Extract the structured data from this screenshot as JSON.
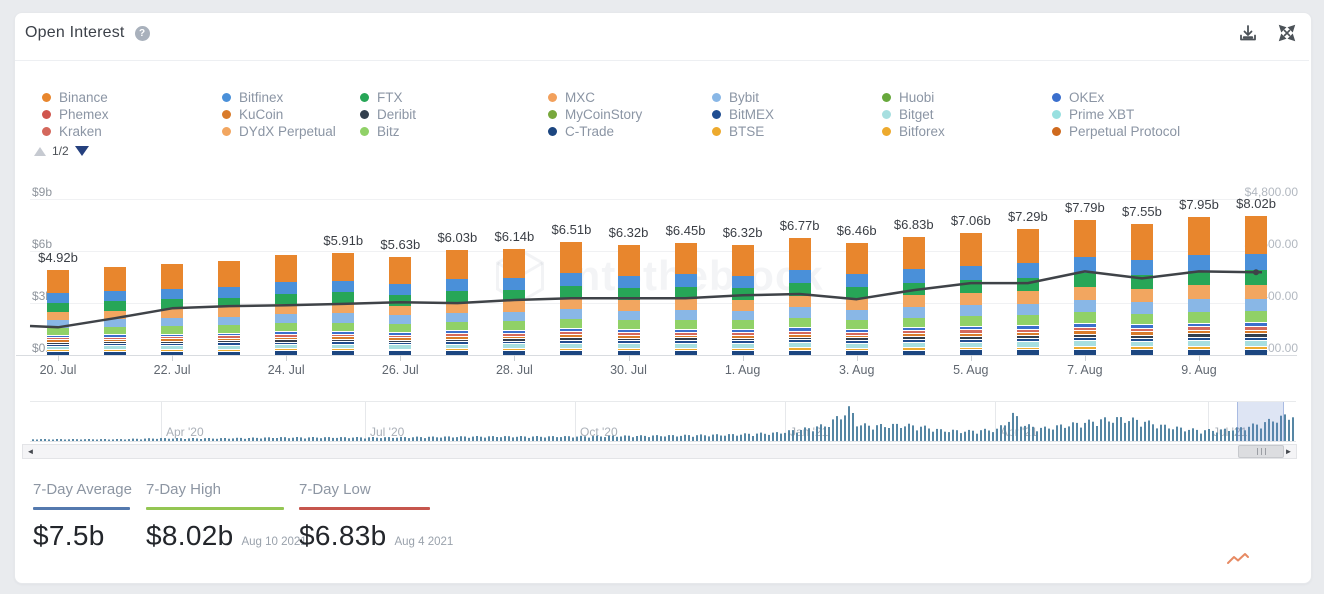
{
  "header": {
    "title": "Open Interest",
    "help_icon": "question-mark-icon",
    "download_icon": "download-icon",
    "expand_icon": "expand-icon"
  },
  "legend": {
    "pagination": {
      "label": "1/2",
      "up_icon": "triangle-up-icon",
      "down_icon": "triangle-down-icon"
    },
    "columns": [
      [
        {
          "name": "Binance",
          "color": "#e8862d"
        },
        {
          "name": "Phemex",
          "color": "#d0564e"
        },
        {
          "name": "Kraken",
          "color": "#d4685c"
        }
      ],
      [
        {
          "name": "Bitfinex",
          "color": "#4a90d9"
        },
        {
          "name": "KuCoin",
          "color": "#d97b2a"
        },
        {
          "name": "DYdX Perpetual",
          "color": "#f2a660"
        }
      ],
      [
        {
          "name": "FTX",
          "color": "#27a657"
        },
        {
          "name": "Deribit",
          "color": "#333f4d"
        },
        {
          "name": "Bitz",
          "color": "#90d167"
        }
      ],
      [
        {
          "name": "MXC",
          "color": "#f2a05c"
        },
        {
          "name": "MyCoinStory",
          "color": "#78a83c"
        },
        {
          "name": "C-Trade",
          "color": "#1c4680"
        }
      ],
      [
        {
          "name": "Bybit",
          "color": "#89b7e6"
        },
        {
          "name": "BitMEX",
          "color": "#1f4d91"
        },
        {
          "name": "BTSE",
          "color": "#edaa2e"
        }
      ],
      [
        {
          "name": "Huobi",
          "color": "#67a83c"
        },
        {
          "name": "Bitget",
          "color": "#a7dfe0"
        },
        {
          "name": "Bitforex",
          "color": "#edaa2e"
        }
      ],
      [
        {
          "name": "OKEx",
          "color": "#3b6fcd"
        },
        {
          "name": "Prime XBT",
          "color": "#98e0e0"
        },
        {
          "name": "Perpetual Protocol",
          "color": "#cf6a1e"
        }
      ]
    ]
  },
  "watermark": "intotheblock",
  "chart_data": {
    "type": "bar",
    "stacked": true,
    "title": "Open Interest",
    "x": [
      "Jul 20",
      "Jul 21",
      "Jul 22",
      "Jul 23",
      "Jul 24",
      "Jul 25",
      "Jul 26",
      "Jul 27",
      "Jul 28",
      "Jul 29",
      "Jul 30",
      "Jul 31",
      "Aug 1",
      "Aug 2",
      "Aug 3",
      "Aug 4",
      "Aug 5",
      "Aug 6",
      "Aug 7",
      "Aug 8",
      "Aug 9",
      "Aug 10"
    ],
    "values": [
      4.92,
      5.08,
      5.26,
      5.43,
      5.78,
      5.91,
      5.63,
      6.03,
      6.14,
      6.51,
      6.32,
      6.45,
      6.32,
      6.77,
      6.46,
      6.83,
      7.06,
      7.29,
      7.79,
      7.55,
      7.95,
      8.02
    ],
    "bar_labels": [
      "$4.92b",
      null,
      null,
      null,
      null,
      "$5.91b",
      "$5.63b",
      "$6.03b",
      "$6.14b",
      "$6.51b",
      "$6.32b",
      "$6.45b",
      "$6.32b",
      "$6.77b",
      "$6.46b",
      "$6.83b",
      "$7.06b",
      "$7.29b",
      "$7.79b",
      "$7.55b",
      "$7.95b",
      "$8.02b"
    ],
    "x_tick_labels": [
      "20. Jul",
      "22. Jul",
      "24. Jul",
      "26. Jul",
      "28. Jul",
      "30. Jul",
      "1. Aug",
      "3. Aug",
      "5. Aug",
      "7. Aug",
      "9. Aug"
    ],
    "left_axis": {
      "unit": "$b",
      "range": [
        0,
        9
      ],
      "ticks": [
        {
          "v": 0,
          "label": "$0.00"
        },
        {
          "v": 3,
          "label": "$3b"
        },
        {
          "v": 6,
          "label": "$6b"
        },
        {
          "v": 9,
          "label": "$9b"
        }
      ]
    },
    "right_axis": {
      "unit": "$",
      "ticks": [
        {
          "v": 1200,
          "label": "$1,200.00"
        },
        {
          "v": 2400,
          "label": "$2,400.00"
        },
        {
          "v": 3600,
          "label": "$3,600.00"
        },
        {
          "v": 4800,
          "label": "$4,800.00"
        }
      ]
    },
    "price_line": {
      "name": "price-line",
      "color": "#3f4348",
      "values": [
        1700,
        1910,
        2140,
        2190,
        2210,
        2240,
        2280,
        2260,
        2330,
        2370,
        2370,
        2370,
        2440,
        2470,
        2350,
        2560,
        2720,
        2720,
        2990,
        2830,
        2990,
        2970
      ]
    },
    "stack_profile": [
      {
        "name": "Binance",
        "color": "#e8862d",
        "frac": 0.275,
        "stripe": false
      },
      {
        "name": "Bitfinex",
        "color": "#4a90d9",
        "frac": 0.115,
        "stripe": false
      },
      {
        "name": "FTX",
        "color": "#27a657",
        "frac": 0.105,
        "stripe": false
      },
      {
        "name": "DYdX Perpetual",
        "color": "#f2a660",
        "frac": 0.1,
        "stripe": false
      },
      {
        "name": "Bybit",
        "color": "#89b7e6",
        "frac": 0.09,
        "stripe": false
      },
      {
        "name": "Bitz",
        "color": "#90d167",
        "frac": 0.08,
        "stripe": false
      },
      {
        "name": "OKEx",
        "color": "#3b6fcd",
        "frac": 0.027,
        "stripe": true
      },
      {
        "name": "Kraken",
        "color": "#d4685c",
        "frac": 0.026,
        "stripe": true
      },
      {
        "name": "KuCoin",
        "color": "#d97b2a",
        "frac": 0.026,
        "stripe": true
      },
      {
        "name": "Deribit",
        "color": "#333f4d",
        "frac": 0.024,
        "stripe": true
      },
      {
        "name": "BitMEX",
        "color": "#1f4d91",
        "frac": 0.024,
        "stripe": true
      },
      {
        "name": "Bitget",
        "color": "#a7dfe0",
        "frac": 0.043,
        "stripe": true
      },
      {
        "name": "BTSE",
        "color": "#edaa2e",
        "frac": 0.02,
        "stripe": true
      },
      {
        "name": "C-Trade",
        "color": "#1c4680",
        "frac": 0.045,
        "stripe": true
      }
    ]
  },
  "navigator": {
    "labels": [
      "Apr '20",
      "Jul '20",
      "Oct '20",
      "Jan '21",
      "Apr '21",
      "Jul '21"
    ],
    "bar_color": "#5586a4",
    "profile": [
      [
        0,
        2
      ],
      [
        0.07,
        2
      ],
      [
        0.1,
        3
      ],
      [
        0.15,
        3
      ],
      [
        0.2,
        4
      ],
      [
        0.28,
        4
      ],
      [
        0.35,
        5
      ],
      [
        0.42,
        5
      ],
      [
        0.5,
        6
      ],
      [
        0.55,
        7
      ],
      [
        0.59,
        9
      ],
      [
        0.61,
        13
      ],
      [
        0.63,
        18
      ],
      [
        0.648,
        36
      ],
      [
        0.655,
        18
      ],
      [
        0.67,
        17
      ],
      [
        0.69,
        18
      ],
      [
        0.705,
        16
      ],
      [
        0.72,
        12
      ],
      [
        0.74,
        11
      ],
      [
        0.765,
        13
      ],
      [
        0.778,
        30
      ],
      [
        0.785,
        18
      ],
      [
        0.8,
        14
      ],
      [
        0.815,
        17
      ],
      [
        0.83,
        20
      ],
      [
        0.85,
        24
      ],
      [
        0.865,
        25
      ],
      [
        0.88,
        22
      ],
      [
        0.895,
        17
      ],
      [
        0.91,
        14
      ],
      [
        0.925,
        12
      ],
      [
        0.94,
        12
      ],
      [
        0.955,
        14
      ],
      [
        0.965,
        17
      ],
      [
        0.975,
        20
      ],
      [
        0.985,
        25
      ],
      [
        1,
        30
      ]
    ]
  },
  "scrollbar": {
    "left_arrow": "◄",
    "right_arrow": "►"
  },
  "stats": [
    {
      "label": "7-Day Average",
      "value": "$7.5b",
      "date": "",
      "underline_color": "#5479ae"
    },
    {
      "label": "7-Day High",
      "value": "$8.02b",
      "date": "Aug 10 2021",
      "underline_color": "#94c653"
    },
    {
      "label": "7-Day Low",
      "value": "$6.83b",
      "date": "Aug 4 2021",
      "underline_color": "#c6564d"
    }
  ],
  "misc": {
    "sparkline_icon_color": "#e78a63"
  }
}
